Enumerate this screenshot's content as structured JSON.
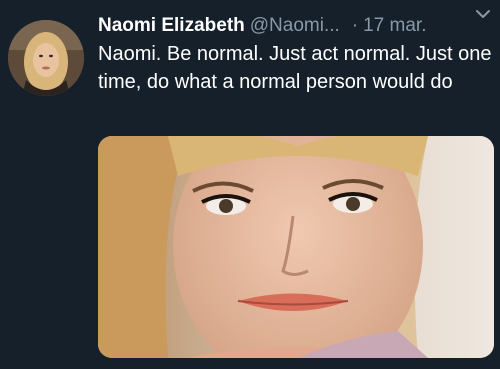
{
  "tweet": {
    "display_name": "Naomi Elizabeth",
    "handle": "@Naomi...",
    "separator": "·",
    "date": "17 mar.",
    "text": "Naomi. Be normal. Just act normal. Just one time, do what a normal person would do",
    "icons": {
      "menu": "chevron-down-icon"
    }
  },
  "colors": {
    "background": "#15202b",
    "secondary_text": "#8899a6",
    "primary_text": "#ffffff"
  }
}
